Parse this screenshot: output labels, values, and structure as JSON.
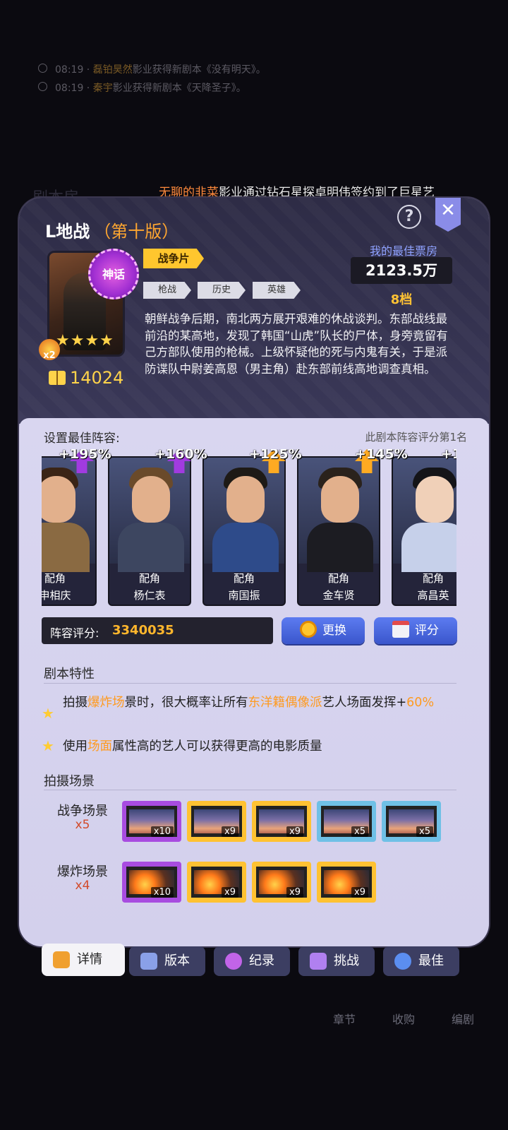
{
  "background": {
    "log": [
      {
        "time": "08:19",
        "name": "磊铂昊然",
        "text": "影业获得新剧本《没有明天》。"
      },
      {
        "time": "08:19",
        "name": "秦宇",
        "text": "影业获得新剧本《天降圣子》。"
      }
    ],
    "marquee": {
      "prefix": "无聊的",
      "highlight": "韭菜",
      "text": "影业通过钻石星探卓明伟签约到了巨星艺"
    },
    "title": "剧本房",
    "nav": [
      "章节",
      "收购",
      "编剧"
    ]
  },
  "script": {
    "title": "L地战",
    "edition": "（第十版）",
    "badge": "神话",
    "stars": "★★★★",
    "multiplier": "x2",
    "likes": "14024",
    "genre": "战争片",
    "tags": [
      "枪战",
      "历史",
      "英雄"
    ],
    "description": "朝鲜战争后期，南北两方展开艰难的休战谈判。东部战线最前沿的某高地，发现了韩国“山虎”队长的尸体，身旁竟留有己方部队使用的枪械。上级怀疑他的死与内鬼有关，于是派防谍队中尉姜高恩（男主角）赴东部前线高地调查真相。",
    "best_box_label": "我的最佳票房",
    "best_box_value": "2123.5万",
    "grade": "8档"
  },
  "lineup": {
    "title": "设置最佳阵容:",
    "rank": "此剧本阵容评分第1名",
    "cards": [
      {
        "boost": "+195%",
        "role": "配角",
        "name": "申相庆",
        "arrow_color": "#a13be0"
      },
      {
        "boost": "+160%",
        "role": "配角",
        "name": "杨仁表",
        "arrow_color": "#a13be0"
      },
      {
        "boost": "+125%",
        "role": "配角",
        "name": "南国振",
        "arrow_color": "#ffaa22"
      },
      {
        "boost": "+145%",
        "role": "配角",
        "name": "金车贤",
        "arrow_color": "#ffaa22"
      },
      {
        "boost": "+1",
        "role": "配角",
        "name": "高昌英",
        "arrow_color": "#ffaa22"
      }
    ],
    "score_label": "阵容评分:",
    "score_value": "3340035",
    "replace_label": "更换",
    "rate_label": "评分"
  },
  "traits": {
    "title": "剧本特性",
    "items": [
      {
        "a": "拍摄",
        "b": "爆炸场",
        "c": "景时，很大概率让所有",
        "d": "东洋籍偶像派",
        "e": "艺人场面发挥+",
        "f": "60%"
      },
      {
        "a": "使用",
        "b": "场面",
        "c": "属性高的艺人可以获得更高的电影质量"
      }
    ]
  },
  "scenes": {
    "title": "拍摄场景",
    "rows": [
      {
        "label": "战争场景",
        "count": "x5",
        "items": [
          {
            "qty": "x10",
            "tier": "purple"
          },
          {
            "qty": "x9",
            "tier": "gold"
          },
          {
            "qty": "x9",
            "tier": "gold"
          },
          {
            "qty": "x5",
            "tier": "blue"
          },
          {
            "qty": "x5",
            "tier": "blue"
          }
        ]
      },
      {
        "label": "爆炸场景",
        "count": "x4",
        "items": [
          {
            "qty": "x10",
            "tier": "purple"
          },
          {
            "qty": "x9",
            "tier": "gold"
          },
          {
            "qty": "x9",
            "tier": "gold"
          },
          {
            "qty": "x9",
            "tier": "gold"
          }
        ]
      }
    ]
  },
  "tabs": [
    {
      "label": "详情",
      "icon": "document-icon",
      "color": "#f0a030"
    },
    {
      "label": "版本",
      "icon": "question-card-icon",
      "color": "#8aa0e8"
    },
    {
      "label": "纪录",
      "icon": "record-badge-icon",
      "color": "#c264e8"
    },
    {
      "label": "挑战",
      "icon": "crown-icon",
      "color": "#b080f0"
    },
    {
      "label": "最佳",
      "icon": "medal-icon",
      "color": "#5b8ef0"
    }
  ]
}
